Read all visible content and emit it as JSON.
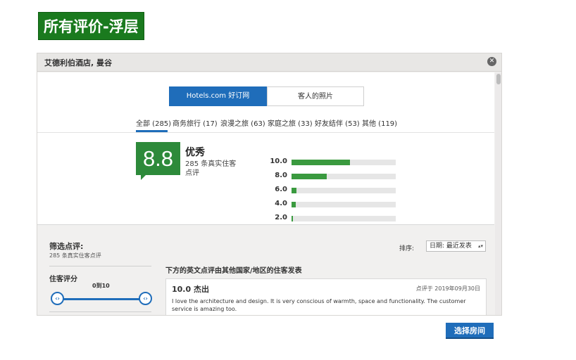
{
  "page_label": "所有评价-浮层",
  "modal": {
    "title": "艾德利伯酒店, 曼谷",
    "close_icon": "close-icon"
  },
  "source_toggle": {
    "active": "Hotels.com 好订网",
    "inactive": "客人的照片"
  },
  "tabs": [
    {
      "label": "全部 (285)",
      "active": true
    },
    {
      "label": "商务旅行 (17)",
      "active": false
    },
    {
      "label": "浪漫之旅 (63)",
      "active": false
    },
    {
      "label": "家庭之旅 (33)",
      "active": false
    },
    {
      "label": "好友结伴 (53)",
      "active": false
    },
    {
      "label": "其他 (119)",
      "active": false
    }
  ],
  "summary": {
    "score": "8.8",
    "rating_word": "优秀",
    "count_text": "285 条真实住客点评",
    "score_color": "#2d8a3a"
  },
  "chart_data": {
    "type": "bar",
    "orientation": "horizontal",
    "categories": [
      "10.0",
      "8.0",
      "6.0",
      "4.0",
      "2.0"
    ],
    "values": [
      0.56,
      0.34,
      0.05,
      0.04,
      0.01
    ],
    "color": "#3a9a3f"
  },
  "filters": {
    "title": "筛选点评:",
    "subtitle": "285 条真实住客点评",
    "rating_title": "住客评分",
    "range_text": "0到10"
  },
  "sort": {
    "label": "排序:",
    "selected": "日期: 最近发表"
  },
  "reviews_heading": "下方的英文点评由其他国家/地区的住客发表",
  "reviews": [
    {
      "score_text": "10.0 杰出",
      "date": "点评于 2019年09月30日",
      "text": "I love the architecture and design. It is very conscious of warmth, space and functionality. The customer service is amazing too."
    }
  ],
  "cta": {
    "label": "选择房间",
    "color": "#1f6dba"
  }
}
